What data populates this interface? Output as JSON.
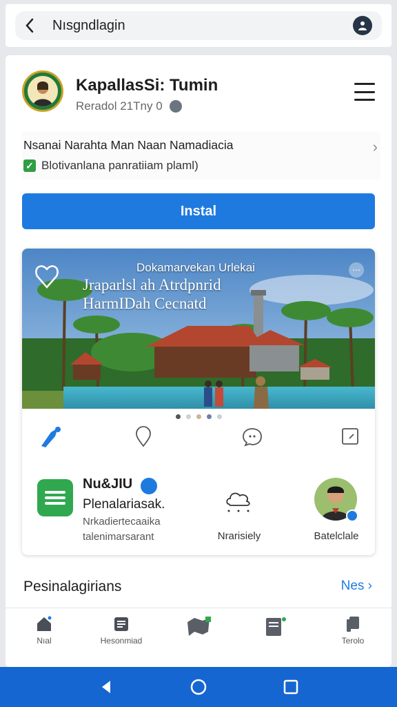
{
  "search": {
    "query": "Nısgndlagin"
  },
  "app": {
    "title": "KapallasSi: Tumin",
    "subtitle": "Reradol 21Tny  0"
  },
  "info": {
    "title": "Nsanai Narahta Man Naan Namadiacia",
    "check_label": "Blotivanlana panratiiam plaml)"
  },
  "install_label": "Instal",
  "promo": {
    "hero_line1": "Dokamarvekan Urlekai",
    "hero_line2": "Jraparlsl ah Atrdpnrid",
    "hero_line3": "HarmIDah Cecnatd"
  },
  "feature": {
    "name": "Nu&JIU",
    "sub": "Plenalariasak.",
    "desc1": "Nrkadiertecaaika",
    "desc2": "talenimarsarant"
  },
  "cloud_label": "Nrarisiely",
  "avatar_label": "Batelclale",
  "section": {
    "title": "Pesinalagirians",
    "link": "Nes"
  },
  "tabs": [
    {
      "label": "Nıal",
      "icon": "home-icon"
    },
    {
      "label": "Hesonmiad",
      "icon": "news-icon"
    },
    {
      "label": "",
      "icon": "map-icon"
    },
    {
      "label": "",
      "icon": "desk-icon"
    },
    {
      "label": "Terolo",
      "icon": "files-icon"
    }
  ],
  "colors": {
    "accent": "#1f7ae0",
    "nav": "#1566d0",
    "success": "#2fa84f"
  }
}
